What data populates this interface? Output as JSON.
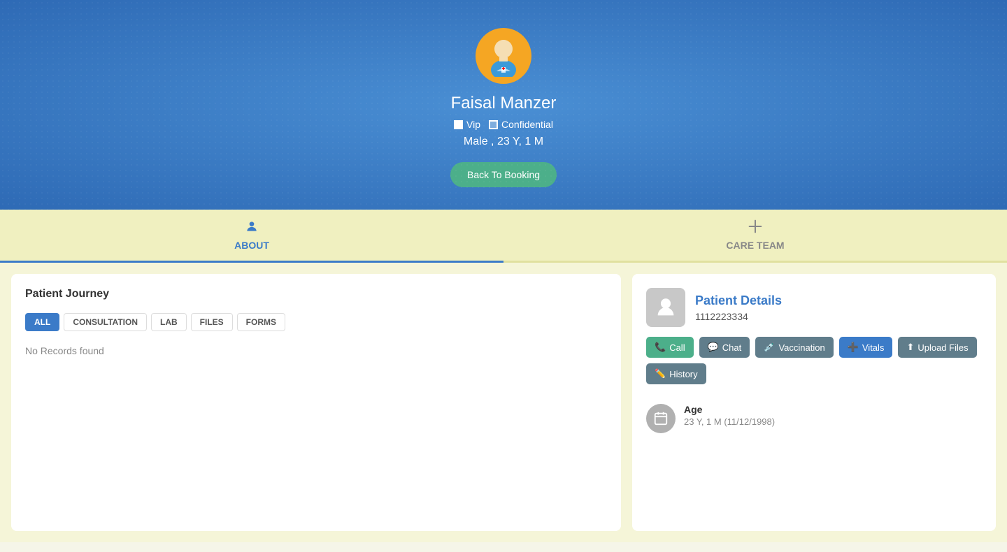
{
  "header": {
    "patient_name": "Faisal Manzer",
    "vip_label": "Vip",
    "confidential_label": "Confidential",
    "demographics": "Male , 23 Y, 1 M",
    "back_button_label": "Back To Booking"
  },
  "nav": {
    "tabs": [
      {
        "id": "about",
        "label": "ABOUT",
        "active": true
      },
      {
        "id": "care_team",
        "label": "CARE TEAM",
        "active": false
      }
    ]
  },
  "patient_journey": {
    "title": "Patient Journey",
    "filters": [
      {
        "id": "all",
        "label": "ALL",
        "active": true
      },
      {
        "id": "consultation",
        "label": "CONSULTATION",
        "active": false
      },
      {
        "id": "lab",
        "label": "LAB",
        "active": false
      },
      {
        "id": "files",
        "label": "FILES",
        "active": false
      },
      {
        "id": "forms",
        "label": "FORMS",
        "active": false
      }
    ],
    "no_records_text": "No Records found"
  },
  "patient_details": {
    "section_title": "Patient Details",
    "phone": "1112223334",
    "actions": [
      {
        "id": "call",
        "label": "Call",
        "style": "call"
      },
      {
        "id": "chat",
        "label": "Chat",
        "style": "chat"
      },
      {
        "id": "vaccination",
        "label": "Vaccination",
        "style": "vaccination"
      },
      {
        "id": "vitals",
        "label": "Vitals",
        "style": "vitals"
      },
      {
        "id": "upload_files",
        "label": "Upload Files",
        "style": "upload"
      },
      {
        "id": "history",
        "label": "History",
        "style": "history"
      }
    ],
    "age_label": "Age",
    "age_value": "23 Y, 1 M (11/12/1998)"
  },
  "icons": {
    "person": "👤",
    "plus": "＋",
    "phone": "📞",
    "chat": "💬",
    "syringe": "💉",
    "vitals": "📈",
    "upload": "⬆",
    "history": "📋",
    "calendar": "📅"
  }
}
